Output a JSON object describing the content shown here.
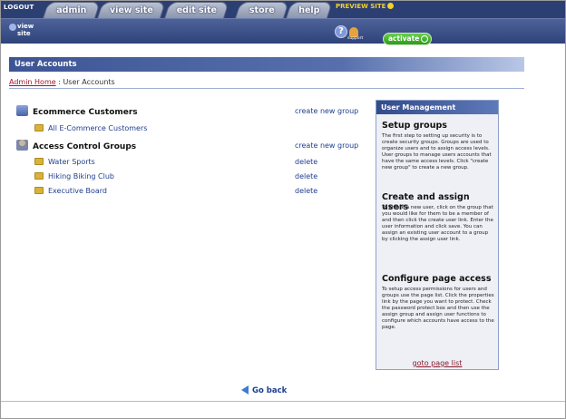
{
  "topbar": {
    "logout": "LOGOUT",
    "tabs": [
      "admin",
      "view site",
      "edit site",
      "store",
      "help"
    ],
    "preview": "PREVIEW SITE"
  },
  "subbar": {
    "view_site": [
      "view",
      "site"
    ],
    "help_icon": "?",
    "support": "support",
    "activate": "activate"
  },
  "page": {
    "title": "User Accounts",
    "breadcrumb_link": "Admin Home",
    "breadcrumb_rest": " : User Accounts"
  },
  "groups": {
    "ecommerce": {
      "label": "Ecommerce Customers",
      "action": "create new group",
      "items": [
        "All E-Commerce Customers"
      ]
    },
    "access": {
      "label": "Access Control Groups",
      "action": "create new group",
      "items": [
        {
          "name": "Water Sports",
          "action": "delete"
        },
        {
          "name": "Hiking Biking Club",
          "action": "delete"
        },
        {
          "name": "Executive Board",
          "action": "delete"
        }
      ]
    }
  },
  "panel": {
    "header": "User Management",
    "sections": [
      {
        "title": "Setup groups",
        "text": "The first step to setting up security is to create security groups. Groups are used to organize users and to assign access levels. User groups to manage users accounts that have the same access levels. Click \"create new group\" to create a new group."
      },
      {
        "title": "Create and assign users",
        "text": "To create a new user, click on the group that you would like for them to be a member of and then click the create user link. Enter the user information and click save. You can assign an existing user account to a group by clicking the assign user link."
      },
      {
        "title": "Configure page access",
        "text": "To setup access permissions for users and groups use the page list. Click the properties link by the page you want to protect. Check the password protect box and then use the assign group and assign user functions to configure which accounts have access to the page."
      }
    ],
    "link": "goto page list"
  },
  "footer": {
    "go_back": "Go back"
  }
}
